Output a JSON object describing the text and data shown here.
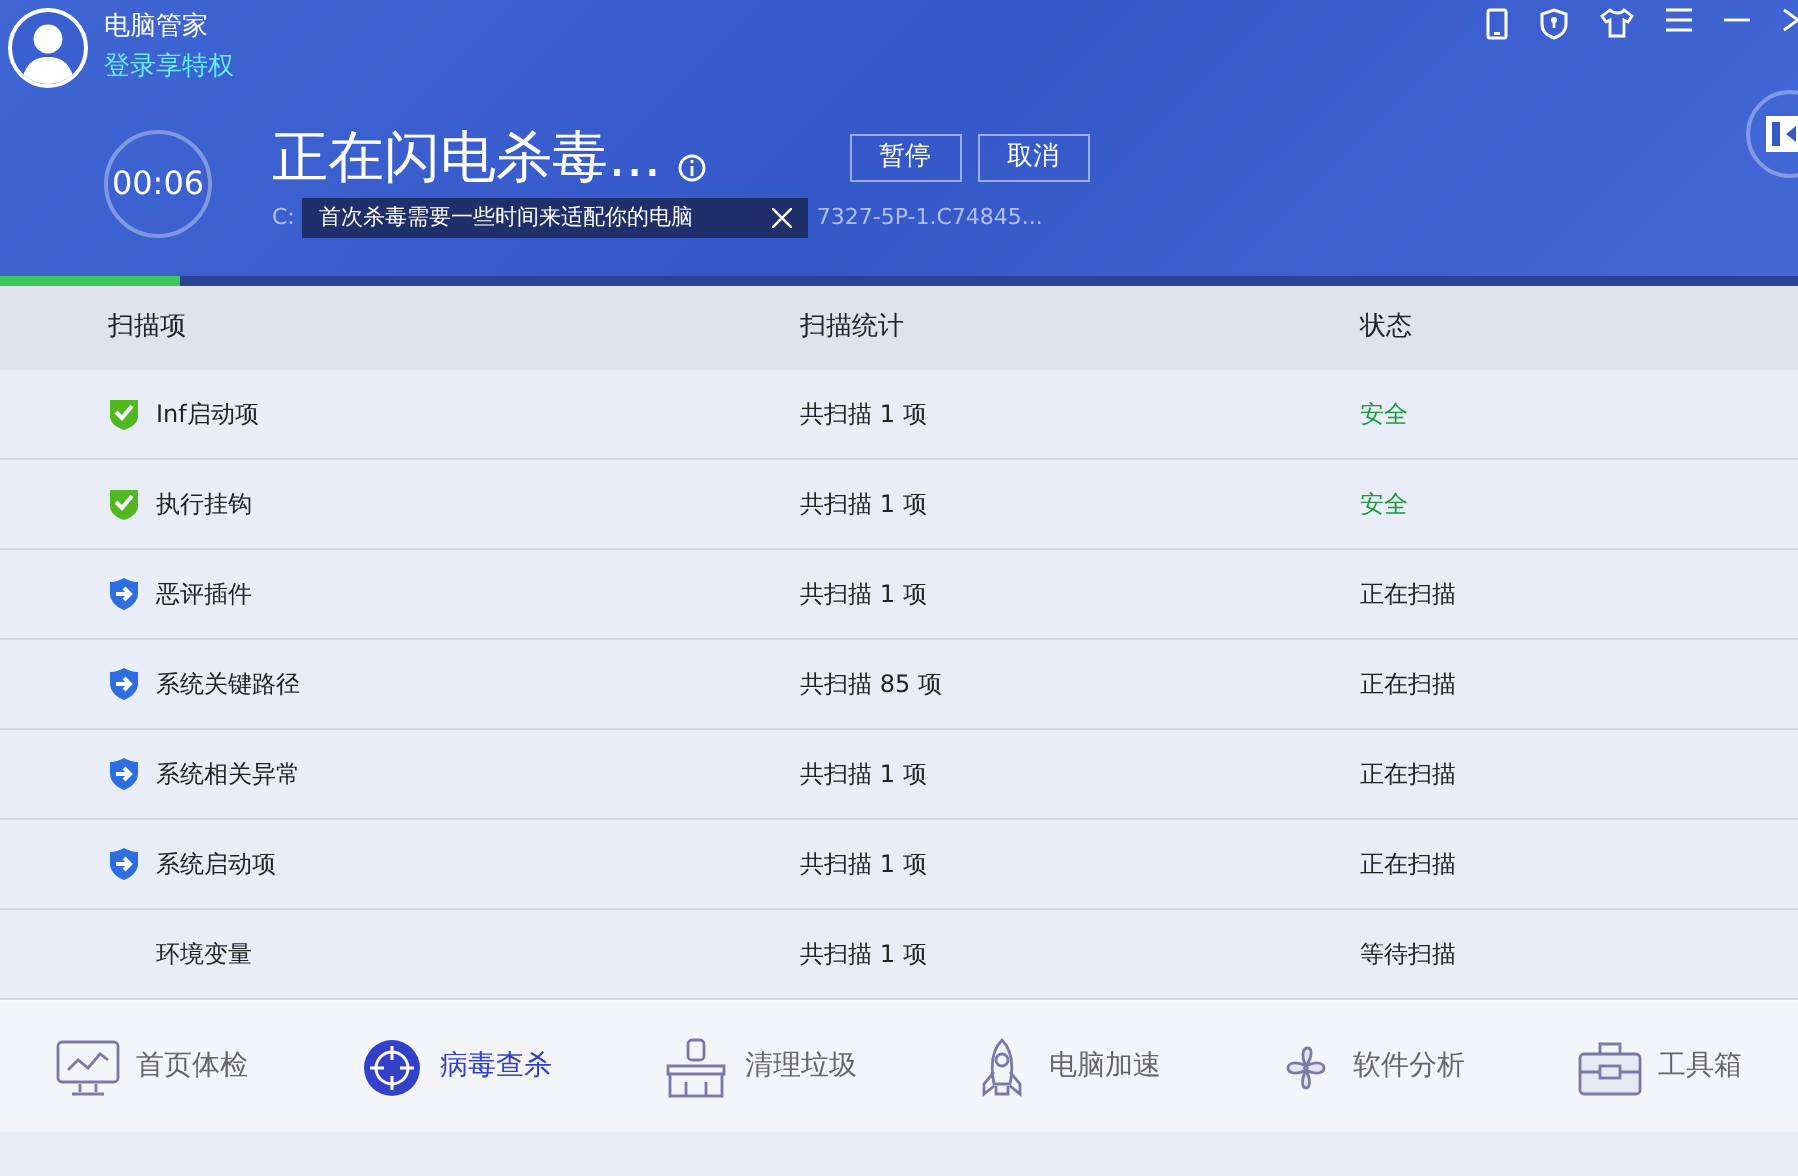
{
  "header": {
    "app_name": "电脑管家",
    "login_link": "登录享特权"
  },
  "scan": {
    "timer": "00:06",
    "title": "正在闪电杀毒...",
    "path_start": "C:",
    "path_end": "7327-5P-1.C74845...",
    "tooltip": "首次杀毒需要一些时间来适配你的电脑",
    "buttons": [
      "暂停",
      "取消"
    ],
    "level": 0.1
  },
  "table": {
    "columns": [
      "扫描项",
      "扫描统计",
      "状态"
    ],
    "rows": [
      {
        "name": "Inf启动项",
        "count": "共扫描 1 项",
        "status": "安全",
        "kind": "safe"
      },
      {
        "name": "执行挂钩",
        "count": "共扫描 1 项",
        "status": "安全",
        "kind": "safe"
      },
      {
        "name": "恶评插件",
        "count": "共扫描 1 项",
        "status": "正在扫描",
        "kind": "scanning"
      },
      {
        "name": "系统关键路径",
        "count": "共扫描 85 项",
        "status": "正在扫描",
        "kind": "scanning"
      },
      {
        "name": "系统相关异常",
        "count": "共扫描 1 项",
        "status": "正在扫描",
        "kind": "scanning"
      },
      {
        "name": "系统启动项",
        "count": "共扫描 1 项",
        "status": "正在扫描",
        "kind": "scanning"
      },
      {
        "name": "环境变量",
        "count": "共扫描 1 项",
        "status": "等待扫描",
        "kind": "waiting"
      }
    ]
  },
  "nav": [
    {
      "label": "首页体检",
      "selected": false
    },
    {
      "label": "病毒查杀",
      "selected": true
    },
    {
      "label": "清理垃圾",
      "selected": false
    },
    {
      "label": "电脑加速",
      "selected": false
    },
    {
      "label": "软件分析",
      "selected": false
    },
    {
      "label": "工具箱",
      "selected": false
    }
  ]
}
